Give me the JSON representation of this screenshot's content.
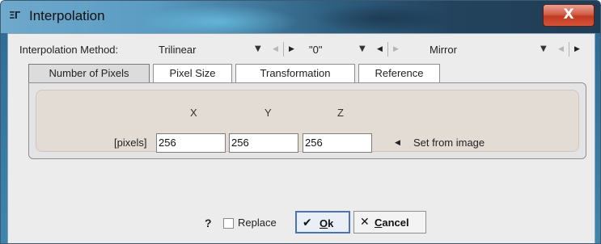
{
  "window": {
    "title": "Interpolation",
    "title_icon": "ΞΓ",
    "close_label": "X"
  },
  "method_row": {
    "label": "Interpolation Method:",
    "method_value": "Trilinear",
    "second_value": "\"0\"",
    "third_value": "Mirror"
  },
  "tabs": [
    {
      "label": "Number of Pixels",
      "active": true
    },
    {
      "label": "Pixel Size",
      "active": false
    },
    {
      "label": "Transformation",
      "active": false
    },
    {
      "label": "Reference",
      "active": false
    }
  ],
  "panel": {
    "col_x": "X",
    "col_y": "Y",
    "col_z": "Z",
    "row_label": "[pixels]",
    "x_value": "256",
    "y_value": "256",
    "z_value": "256",
    "set_from_image": "Set from image"
  },
  "footer": {
    "help": "?",
    "replace_label": "Replace",
    "replace_checked": false,
    "ok_glyph": "✔",
    "ok_label_underlined": "O",
    "ok_label_rest": "k",
    "cancel_glyph": "✕",
    "cancel_label_underlined": "C",
    "cancel_label_rest": "ancel"
  },
  "colors": {
    "title_bar": "#2f5f80",
    "close_button": "#c23b22",
    "client_bg": "#ececec",
    "panel_inner": "#e3dcd5",
    "ok_border": "#4a74b0"
  },
  "icons": [
    "app-icon",
    "close-icon",
    "dropdown-arrow-icon",
    "left-arrow-icon",
    "right-arrow-icon",
    "help-icon",
    "checkmark-icon",
    "cancel-x-icon"
  ]
}
